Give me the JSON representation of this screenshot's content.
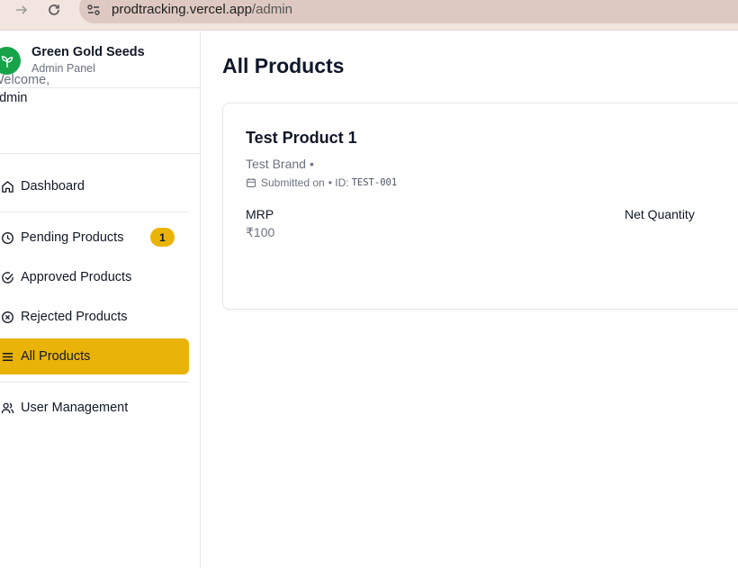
{
  "browser": {
    "url_host": "prodtracking.vercel.app",
    "url_path": "/admin"
  },
  "sidebar": {
    "brand_name": "Green Gold Seeds",
    "brand_sub": "Admin Panel",
    "welcome_text": "Welcome,",
    "welcome_user": "admin",
    "items": [
      {
        "label": "Dashboard",
        "icon": "home-icon"
      },
      {
        "label": "Pending Products",
        "icon": "clock-icon",
        "badge": "1"
      },
      {
        "label": "Approved Products",
        "icon": "check-circle-icon"
      },
      {
        "label": "Rejected Products",
        "icon": "x-circle-icon"
      },
      {
        "label": "All Products",
        "icon": "list-icon",
        "active": true
      },
      {
        "label": "User Management",
        "icon": "users-icon"
      }
    ]
  },
  "main": {
    "title": "All Products",
    "product": {
      "name": "Test Product 1",
      "brand": "Test Brand",
      "brand_sep": "•",
      "submitted": "Submitted on",
      "id_prefix": "• ID:",
      "id": "TEST-001",
      "mrp_label": "MRP",
      "mrp_value": "₹100",
      "net_qty_label": "Net Quantity"
    }
  },
  "colors": {
    "accent": "#eab308",
    "brand": "#16a34a"
  }
}
